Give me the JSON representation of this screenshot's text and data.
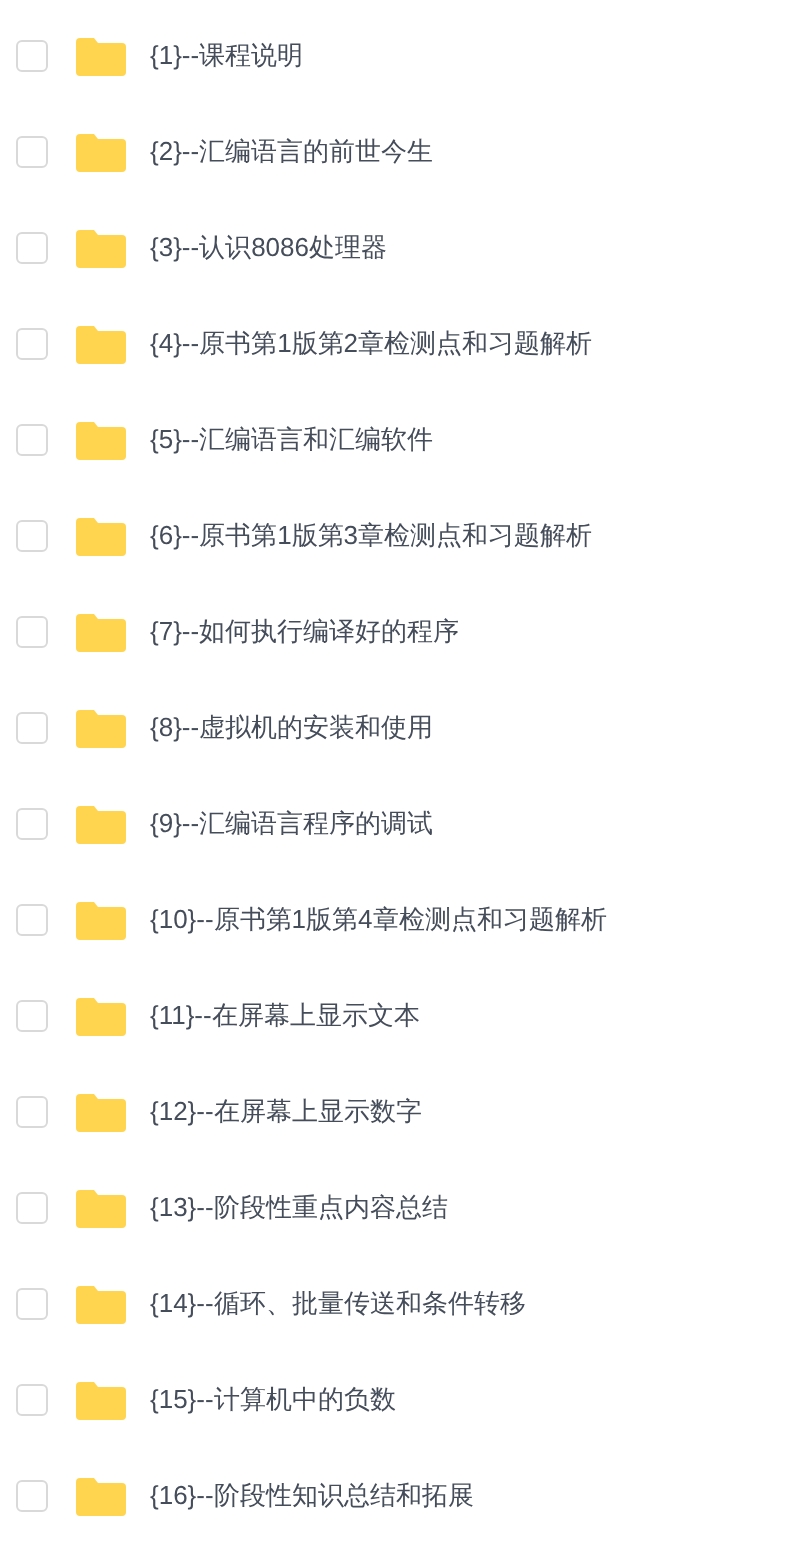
{
  "files": [
    {
      "name": "{1}--课程说明",
      "checked": false
    },
    {
      "name": "{2}--汇编语言的前世今生",
      "checked": false
    },
    {
      "name": "{3}--认识8086处理器",
      "checked": false
    },
    {
      "name": "{4}--原书第1版第2章检测点和习题解析",
      "checked": false
    },
    {
      "name": "{5}--汇编语言和汇编软件",
      "checked": false
    },
    {
      "name": "{6}--原书第1版第3章检测点和习题解析",
      "checked": false
    },
    {
      "name": "{7}--如何执行编译好的程序",
      "checked": false
    },
    {
      "name": "{8}--虚拟机的安装和使用",
      "checked": false
    },
    {
      "name": "{9}--汇编语言程序的调试",
      "checked": false
    },
    {
      "name": "{10}--原书第1版第4章检测点和习题解析",
      "checked": false
    },
    {
      "name": "{11}--在屏幕上显示文本",
      "checked": false
    },
    {
      "name": "{12}--在屏幕上显示数字",
      "checked": false
    },
    {
      "name": "{13}--阶段性重点内容总结",
      "checked": false
    },
    {
      "name": "{14}--循环、批量传送和条件转移",
      "checked": false
    },
    {
      "name": "{15}--计算机中的负数",
      "checked": false
    },
    {
      "name": "{16}--阶段性知识总结和拓展",
      "checked": false
    }
  ]
}
